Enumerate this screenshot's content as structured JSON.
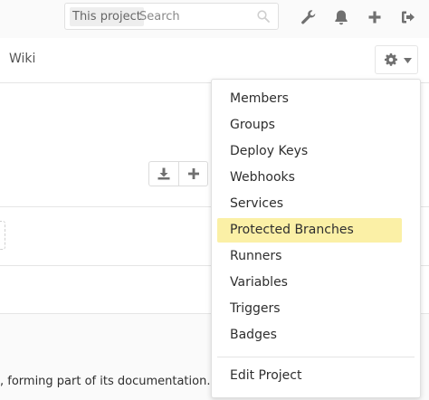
{
  "header": {
    "search_scope": "This project",
    "search_placeholder": "Search",
    "icons": [
      "wrench-icon",
      "bell-icon",
      "plus-icon",
      "sign-out-icon"
    ]
  },
  "nav": {
    "wiki_label": "Wiki"
  },
  "settings_menu": {
    "items": [
      {
        "label": "Members",
        "active": false
      },
      {
        "label": "Groups",
        "active": false
      },
      {
        "label": "Deploy Keys",
        "active": false
      },
      {
        "label": "Webhooks",
        "active": false
      },
      {
        "label": "Services",
        "active": false
      },
      {
        "label": "Protected Branches",
        "active": true
      },
      {
        "label": "Runners",
        "active": false
      },
      {
        "label": "Variables",
        "active": false
      },
      {
        "label": "Triggers",
        "active": false
      },
      {
        "label": "Badges",
        "active": false
      }
    ],
    "edit_project_label": "Edit Project"
  },
  "content": {
    "footer_text": ", forming part of its documentation."
  },
  "colors": {
    "highlight": "#fbf0a6",
    "icon": "#707070",
    "text": "#2e2e2e"
  }
}
